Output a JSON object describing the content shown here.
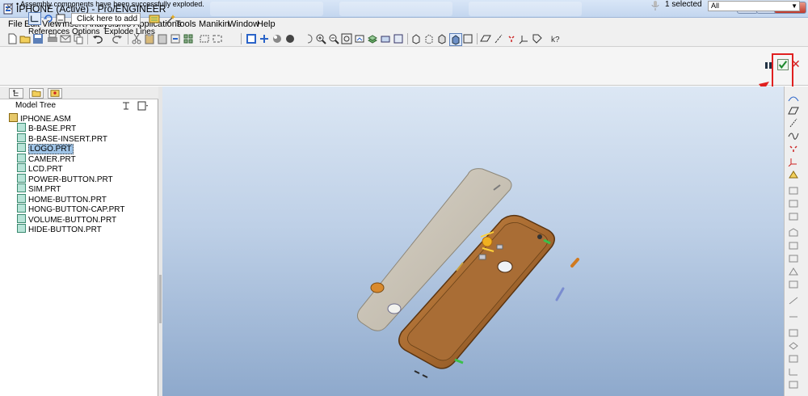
{
  "window": {
    "title": "IPHONE (Active) - Pro/ENGINEER",
    "minimize_label": "–",
    "maximize_label": "□",
    "close_label": "✕"
  },
  "menubar": {
    "items": [
      "File",
      "Edit",
      "View",
      "Insert",
      "Analysis",
      "Info",
      "Applications",
      "Tools",
      "Manikin",
      "Window",
      "Help"
    ]
  },
  "toolbar": {
    "icons": [
      "new-icon",
      "open-icon",
      "save-icon",
      "print-icon",
      "email-icon",
      "copy-icon",
      "undo-icon",
      "redo-icon",
      "cut-icon",
      "paste-icon",
      "paste-special-icon",
      "regenerate-icon",
      "find-icon",
      "select-box-icon",
      "sketch-icon",
      "datum-icon",
      "shading-icon",
      "reorient-icon",
      "pan-icon",
      "zoom-in-icon",
      "zoom-out-icon",
      "refit-icon",
      "named-view-icon",
      "layer-icon",
      "appearance-icon",
      "wireframe-icon",
      "hidden-line-icon",
      "no-hidden-icon",
      "shaded-icon",
      "plane-icon",
      "axis-icon",
      "point-icon",
      "csys-icon",
      "help-icon"
    ]
  },
  "dashboard": {
    "message": "Assembly components have been successfully exploded.",
    "add_item_placeholder": "Click here to add item",
    "tabs": [
      "References",
      "Options",
      "Explode Lines"
    ],
    "selected_count": "1 selected",
    "filter_value": "All",
    "cancel_label": "✕"
  },
  "model_tree": {
    "title": "Model Tree",
    "root": "IPHONE.ASM",
    "items": [
      {
        "label": "B-BASE.PRT",
        "selected": false
      },
      {
        "label": "B-BASE-INSERT.PRT",
        "selected": false
      },
      {
        "label": "LOGO.PRT",
        "selected": true
      },
      {
        "label": "CAMER.PRT",
        "selected": false
      },
      {
        "label": "LCD.PRT",
        "selected": false
      },
      {
        "label": "POWER-BUTTON.PRT",
        "selected": false
      },
      {
        "label": "SIM.PRT",
        "selected": false
      },
      {
        "label": "HOME-BUTTON.PRT",
        "selected": false
      },
      {
        "label": "HONG-BUTTON-CAP.PRT",
        "selected": false
      },
      {
        "label": "VOLUME-BUTTON.PRT",
        "selected": false
      },
      {
        "label": "HIDE-BUTTON.PRT",
        "selected": false
      }
    ]
  },
  "colors": {
    "accent_red": "#e02020",
    "phone_body": "#a86a30",
    "lcd_panel": "#c9c2b4",
    "selection": "#9ec3e6"
  }
}
